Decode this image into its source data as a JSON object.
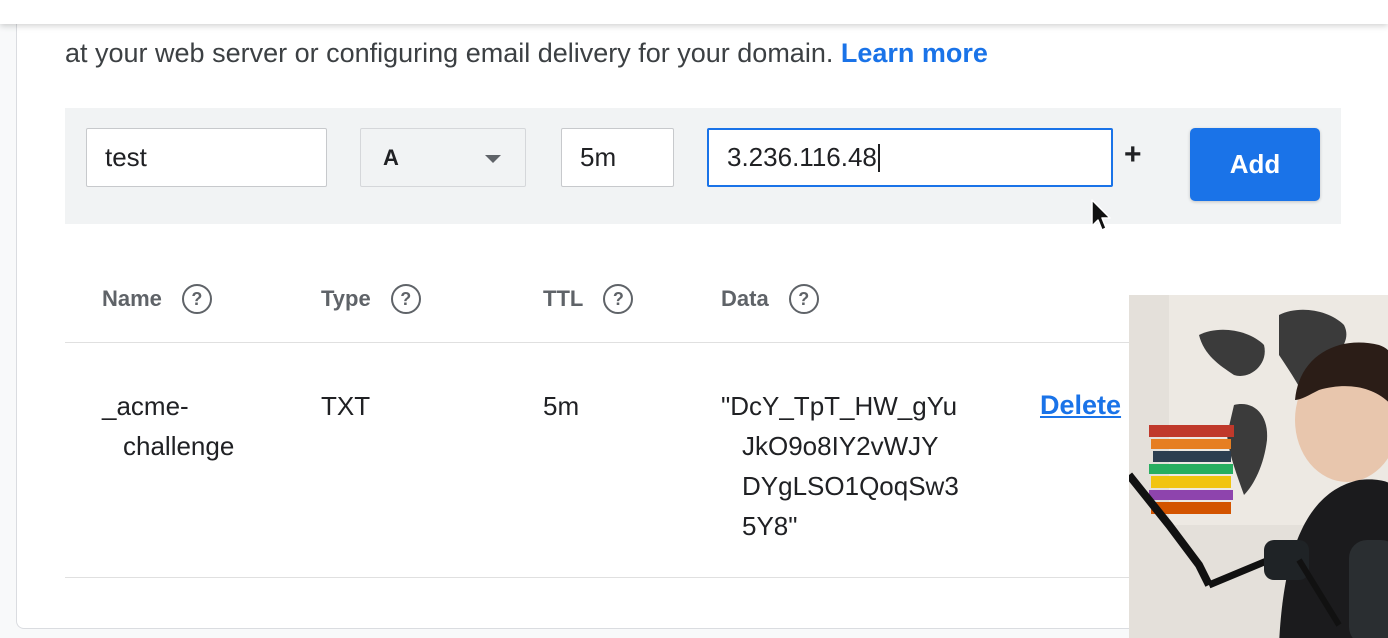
{
  "intro": {
    "text": "at your web server or configuring email delivery for your domain.",
    "learn_more": "Learn more"
  },
  "new_record": {
    "name_value": "test",
    "type_value": "A",
    "ttl_value": "5m",
    "data_value": "3.236.116.48",
    "plus_label": "+",
    "add_label": "Add"
  },
  "columns": [
    {
      "label": "Name"
    },
    {
      "label": "Type"
    },
    {
      "label": "TTL"
    },
    {
      "label": "Data"
    }
  ],
  "help_glyph": "?",
  "records": [
    {
      "name_lines": [
        "_acme-",
        "challenge"
      ],
      "type": "TXT",
      "ttl": "5m",
      "data_lines": [
        "\"DcY_TpT_HW_gYu",
        "JkO9o8IY2vWJY",
        "DYgLSO1QoqSw3",
        "5Y8\""
      ],
      "action": "Delete"
    }
  ],
  "colors": {
    "accent": "#1a73e8",
    "text": "#202124",
    "muted": "#5f6368",
    "bar_bg": "#f1f3f4"
  },
  "icons": {
    "mouse_pointer": "mouse-pointer-icon",
    "dropdown": "chevron-down-icon",
    "help": "help-circle-icon",
    "plus": "plus-icon"
  }
}
